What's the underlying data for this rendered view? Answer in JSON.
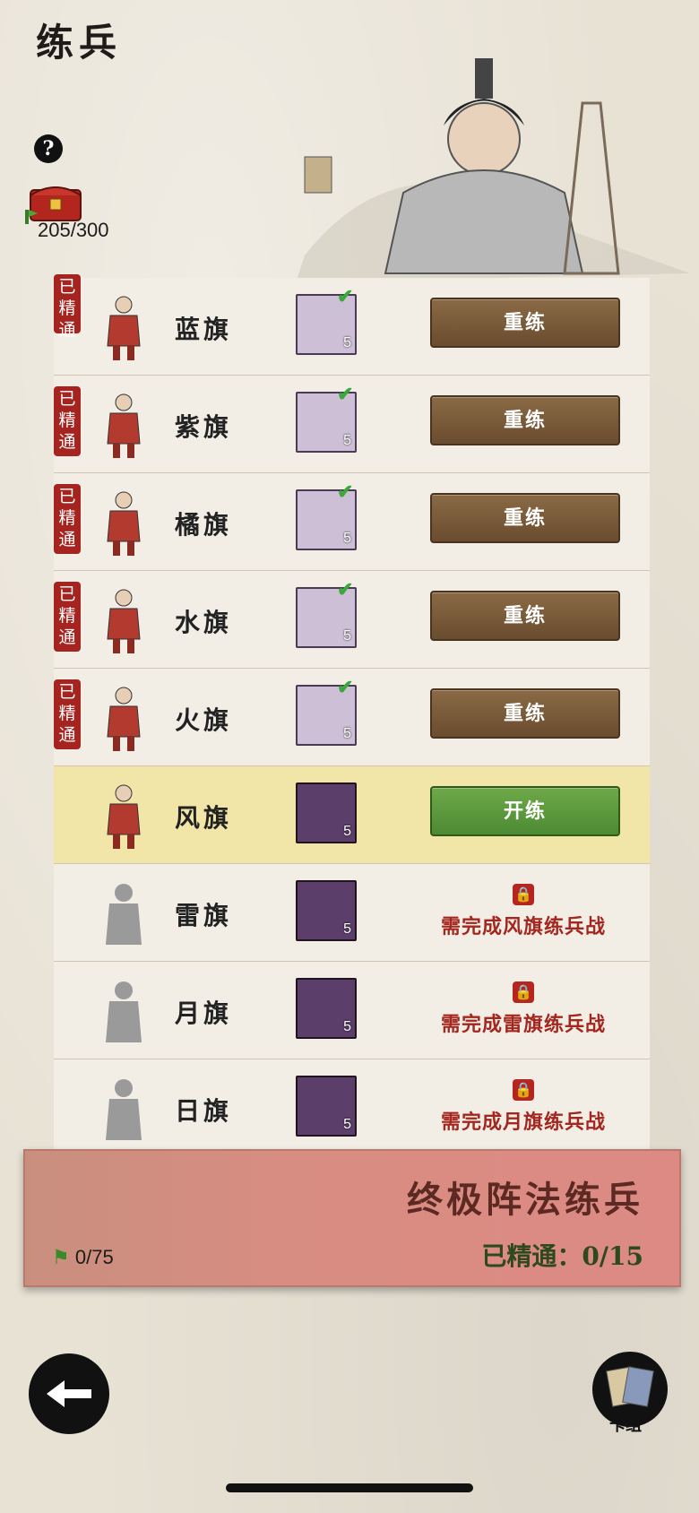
{
  "header": {
    "title": "练兵",
    "help_glyph": "?"
  },
  "resources": {
    "chest_count": "205/300"
  },
  "rows": [
    {
      "name": "蓝旗",
      "badge": "已精通",
      "status": "mastered",
      "scroll_count": "5",
      "action": "重练"
    },
    {
      "name": "紫旗",
      "badge": "已精通",
      "status": "mastered",
      "scroll_count": "5",
      "action": "重练"
    },
    {
      "name": "橘旗",
      "badge": "已精通",
      "status": "mastered",
      "scroll_count": "5",
      "action": "重练"
    },
    {
      "name": "水旗",
      "badge": "已精通",
      "status": "mastered",
      "scroll_count": "5",
      "action": "重练"
    },
    {
      "name": "火旗",
      "badge": "已精通",
      "status": "mastered",
      "scroll_count": "5",
      "action": "重练"
    },
    {
      "name": "风旗",
      "badge": "",
      "status": "available",
      "scroll_count": "5",
      "action": "开练"
    },
    {
      "name": "雷旗",
      "badge": "",
      "status": "locked",
      "scroll_count": "5",
      "requirement": "需完成风旗练兵战"
    },
    {
      "name": "月旗",
      "badge": "",
      "status": "locked",
      "scroll_count": "5",
      "requirement": "需完成雷旗练兵战"
    },
    {
      "name": "日旗",
      "badge": "",
      "status": "locked",
      "scroll_count": "5",
      "requirement": "需完成月旗练兵战"
    }
  ],
  "banner": {
    "title": "终极阵法练兵",
    "progress": "已精通：0/15",
    "flags": "0/75"
  },
  "footer": {
    "cards_label": "卡组"
  },
  "colors": {
    "badge_red": "#a5241f",
    "button_brown": "#7a5a3a",
    "button_green": "#5b9a3c",
    "lock_red": "#b7261e",
    "active_row": "#f1e5a7"
  }
}
